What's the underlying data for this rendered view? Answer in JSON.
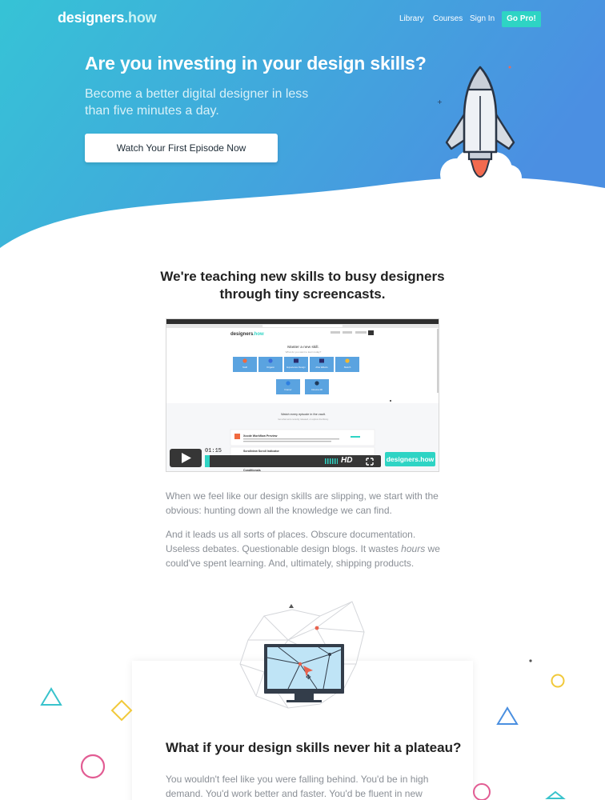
{
  "nav": {
    "logo_main": "designers",
    "logo_tld": ".how",
    "links": [
      "Library",
      "Courses",
      "Sign In"
    ],
    "go_pro": "Go Pro!"
  },
  "hero": {
    "title": "Are you investing in your design skills?",
    "subtitle": "Become a better digital designer in less than five minutes a day.",
    "cta": "Watch Your First Episode Now"
  },
  "teach": {
    "title": "We're teaching new skills to busy designers through tiny screencasts."
  },
  "video": {
    "timecode": "01:15",
    "hd": "HD",
    "brand_main": "designers",
    "brand_tld": ".how",
    "inner_logo_main": "designers",
    "inner_logo_tld": ".how",
    "inner_heading": "Master a new skill.",
    "inner_sub": "What do you want to learn today?",
    "skills": [
      "Swift",
      "Origami",
      "Experience Design",
      "After Effects",
      "Sketch",
      "Framer",
      "Cinema 4D"
    ],
    "vault_title": "Watch every episode in the vault.",
    "vault_sub": "Get what we're recently released, or explore the library.",
    "episodes": [
      "Xcode Workflow Preview",
      "Scrollview Scroll Indicator",
      "Conditionals"
    ]
  },
  "body": {
    "p1": "When we feel like our design skills are slipping, we start with the obvious: hunting down all the knowledge we can find.",
    "p2_before": "And it leads us all sorts of places. Obscure documentation. Useless debates. Questionable design blogs. It wastes ",
    "p2_em": "hours",
    "p2_after": " we could've spent learning. And, ultimately, shipping products."
  },
  "plateau": {
    "title": "What if your design skills never hit a plateau?",
    "p1": "You wouldn't feel like you were falling behind. You'd be in high demand. You'd work better and faster. You'd be fluent in new"
  },
  "colors": {
    "hero_start": "#35c0d6",
    "hero_end": "#4a8fe0",
    "go_pro": "#2ed4c4",
    "brand_accent": "#2ed4c4"
  }
}
